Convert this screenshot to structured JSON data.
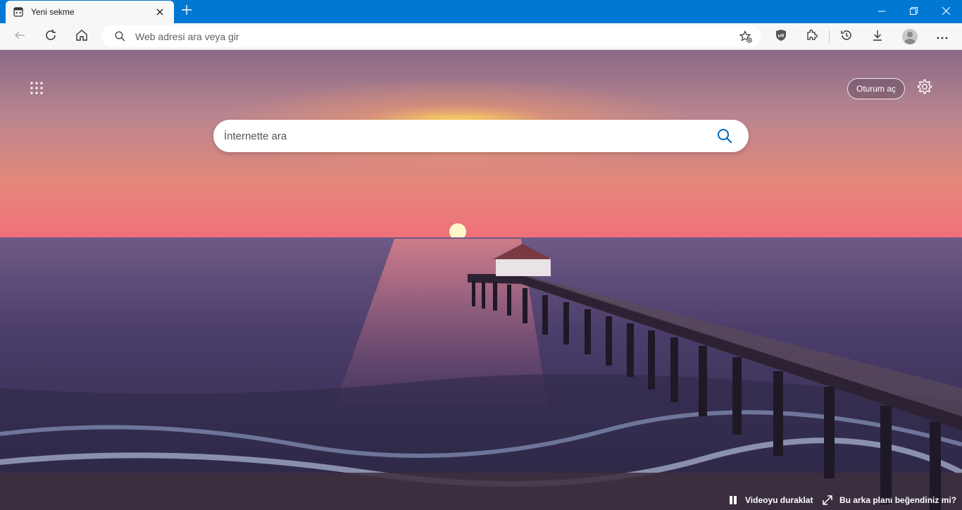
{
  "tab": {
    "title": "Yeni sekme",
    "favicon": "new-tab-page-icon",
    "close_icon": "close-icon"
  },
  "new_tab_icon": "plus-icon",
  "window_controls": [
    "minimize-icon",
    "restore-icon",
    "close-icon"
  ],
  "toolbar": {
    "back_icon": "back-arrow-icon",
    "refresh_icon": "refresh-icon",
    "home_icon": "home-icon",
    "address_placeholder": "Web adresi ara veya gir",
    "address_value": "",
    "favorite_icon": "add-favorite-icon",
    "extension_icons": [
      "ublock-shield-icon",
      "extensions-puzzle-icon",
      "history-icon",
      "downloads-icon",
      "profile-avatar-icon",
      "more-dots-icon"
    ]
  },
  "page": {
    "apps_icon": "app-launcher-grid-icon",
    "signin_label": "Oturum aç",
    "settings_icon": "gear-icon",
    "search_placeholder": "İnternette ara",
    "search_icon": "search-icon",
    "pause_label": "Videoyu duraklat",
    "like_label": "Bu arka planı beğendiniz mi?"
  },
  "colors": {
    "titlebar": "#0078d4",
    "toolbar": "#f7f7f7",
    "accent": "#0067b8"
  }
}
